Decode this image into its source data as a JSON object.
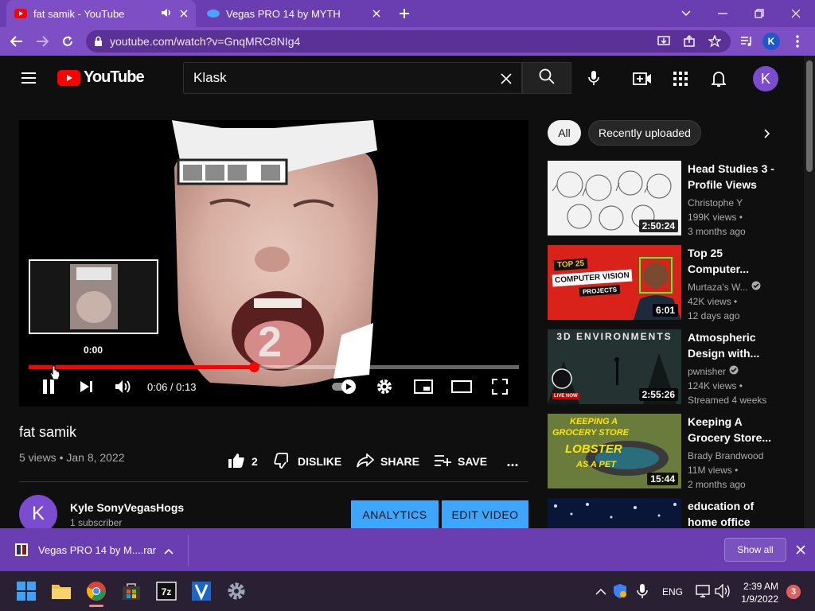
{
  "browser": {
    "tabs": [
      {
        "title": "fat samik - YouTube"
      },
      {
        "title": "Vegas PRO 14 by MYTH"
      }
    ],
    "url": "youtube.com/watch?v=GnqMRC8NIg4",
    "profile_initial": "K"
  },
  "youtube": {
    "logo_text": "YouTube",
    "search_value": "Klask",
    "avatar_initial": "K"
  },
  "player": {
    "hover_time": "0:00",
    "time_display": "0:06 / 0:13",
    "progress": 0.46,
    "watermark_number": "2"
  },
  "video": {
    "title": "fat samik",
    "meta": "5 views • Jan 8, 2022",
    "likes": "2",
    "dislike_label": "DISLIKE",
    "share_label": "SHARE",
    "save_label": "SAVE",
    "more_label": "...",
    "channel_initial": "K",
    "channel_name": "Kyle SonyVegasHogs",
    "subscribers": "1 subscriber",
    "analytics_label": "ANALYTICS",
    "edit_label": "EDIT VIDEO"
  },
  "chips": [
    "All",
    "Recently uploaded"
  ],
  "recommendations": [
    {
      "title": "Head Studies 3 - Profile Views",
      "channel": "Christophe Y",
      "views": "199K views •",
      "age": "3 months ago",
      "duration": "2:50:24"
    },
    {
      "title": "Top 25 Computer...",
      "channel": "Murtaza's W...",
      "views": "42K views •",
      "age": "12 days ago",
      "duration": "6:01",
      "thumb_text_1": "TOP 25",
      "thumb_text_2": "COMPUTER VISION",
      "thumb_text_3": "PROJECTS"
    },
    {
      "title": "Atmospheric Design with...",
      "channel": "pwnisher",
      "views": "124K views •",
      "age": "Streamed 4 weeks",
      "duration": "2:55:26",
      "thumb_text_1": "3D ENVIRONMENTS",
      "thumb_text_2": "LIVE NOW"
    },
    {
      "title": "Keeping A Grocery Store...",
      "channel": "Brady Brandwood",
      "views": "11M views •",
      "age": "2 months ago",
      "duration": "15:44",
      "thumb_text_1": "KEEPING A",
      "thumb_text_2": "GROCERY STORE",
      "thumb_text_3": "LOBSTER",
      "thumb_text_4": "AS A PET"
    },
    {
      "title": "education of home office",
      "channel": "",
      "views": "",
      "age": "",
      "duration": ""
    }
  ],
  "download_bar": {
    "file": "Vegas PRO 14 by M....rar",
    "show_all": "Show all"
  },
  "taskbar": {
    "language": "ENG",
    "time": "2:39 AM",
    "date": "1/9/2022",
    "notifications": "3"
  },
  "colors": {
    "chrome_purple": "#6a3db0",
    "yt_red": "#ff0000",
    "yt_blue": "#3ea6ff",
    "avatar_purple": "#7b4ccf"
  }
}
